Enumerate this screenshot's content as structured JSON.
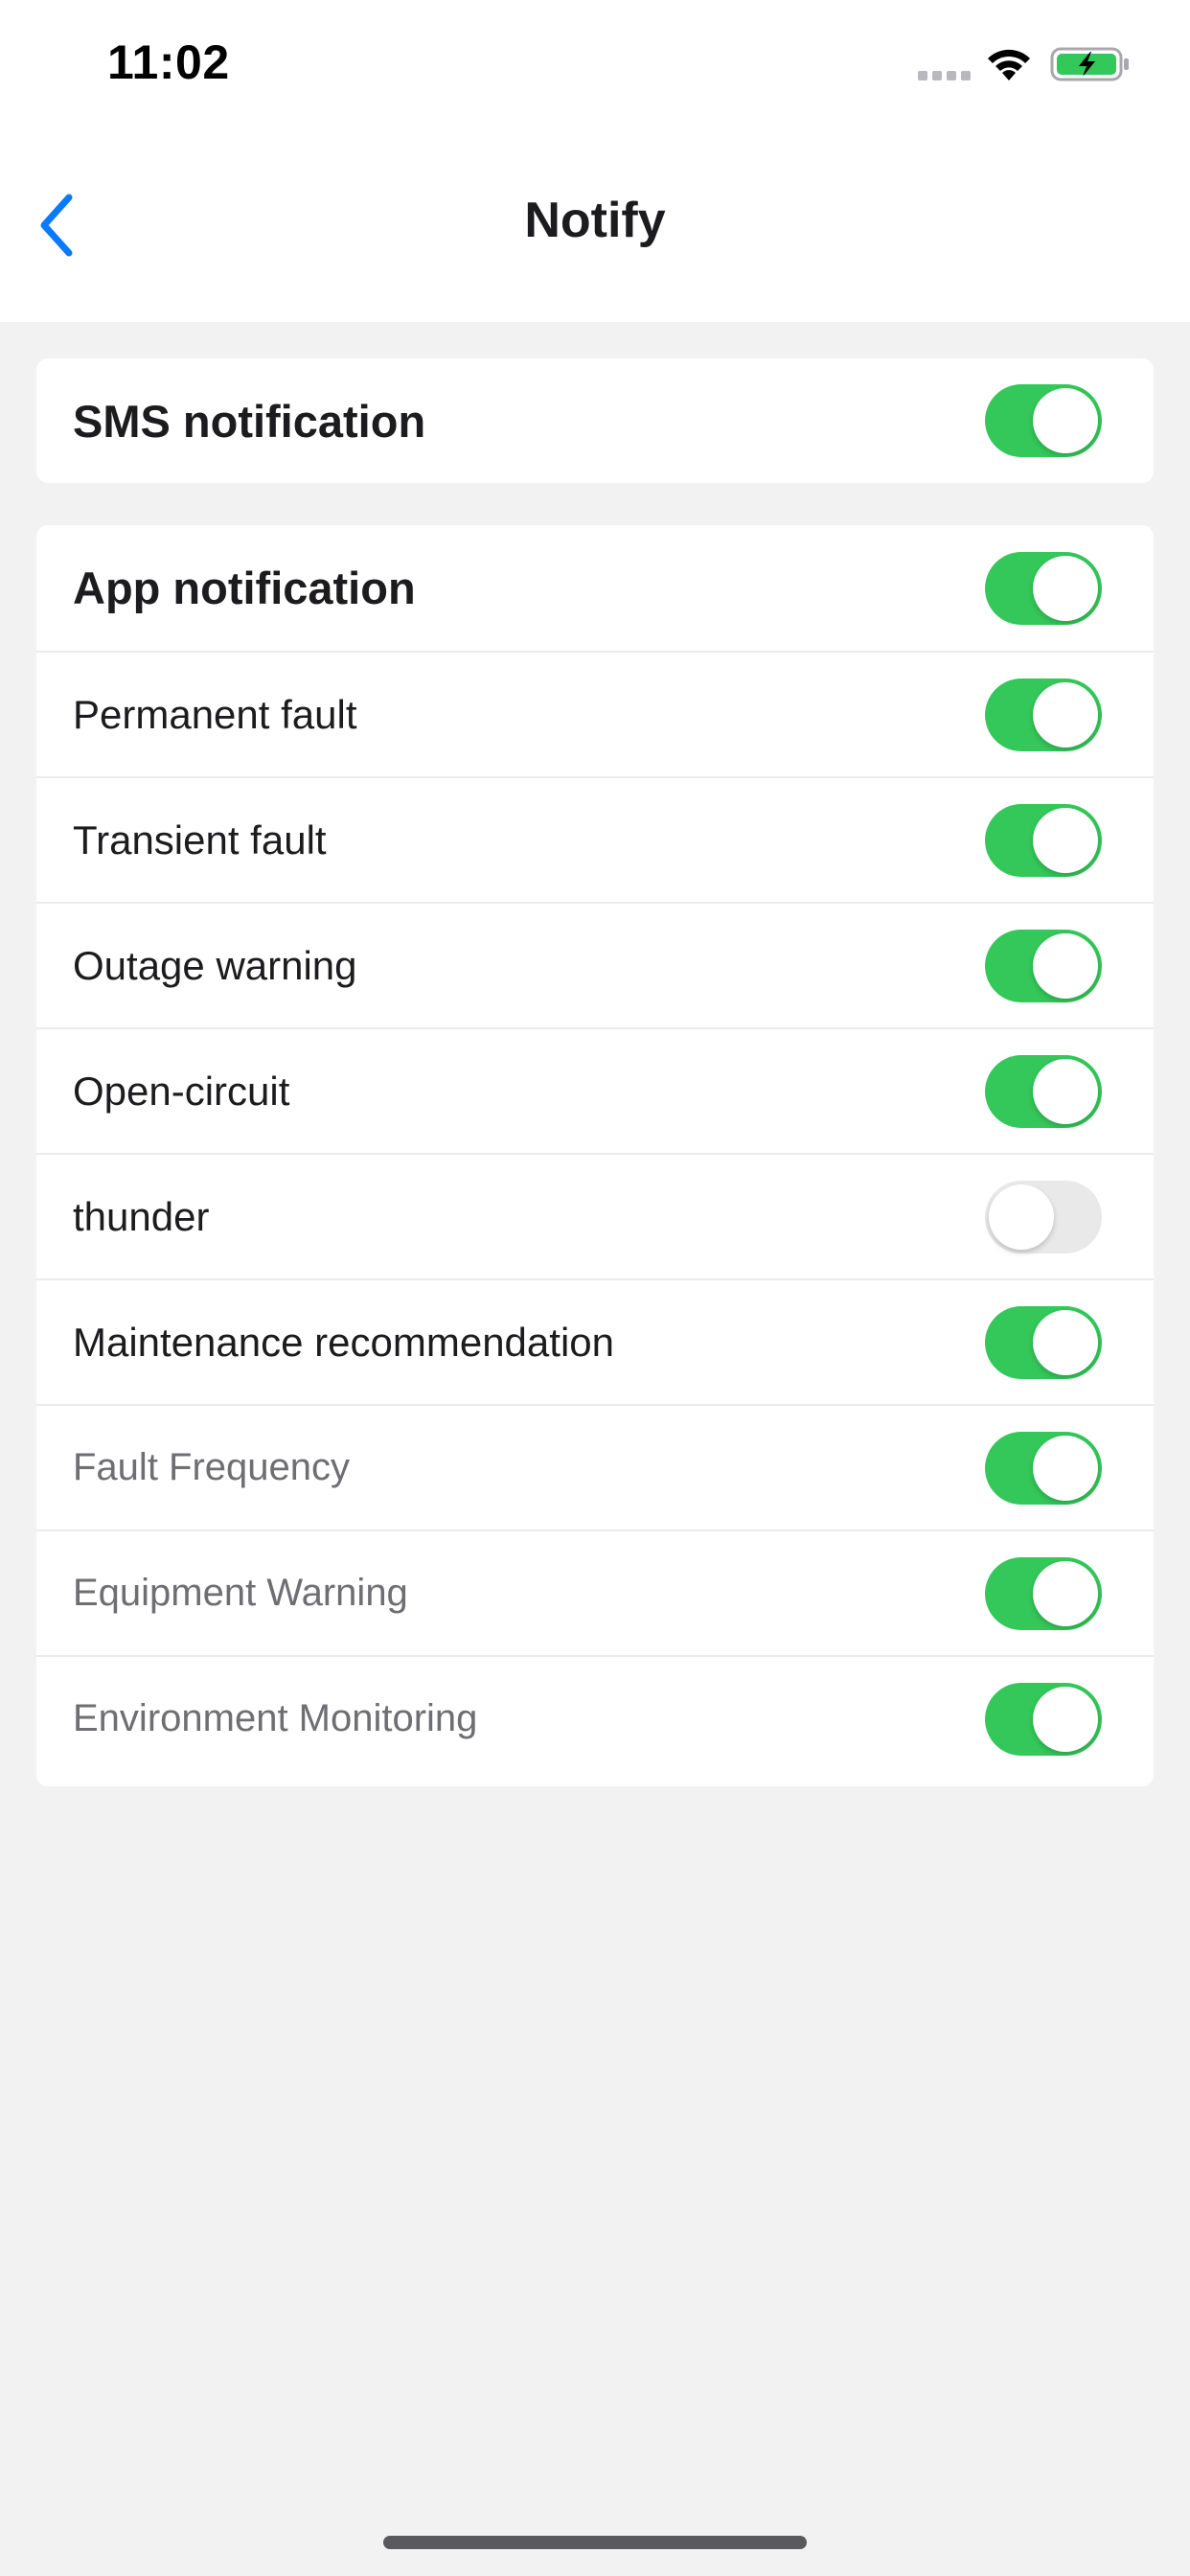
{
  "status_bar": {
    "time": "11:02",
    "signal_icon": "signal-dots-icon",
    "wifi_icon": "wifi-icon",
    "battery_icon": "battery-charging-icon"
  },
  "nav": {
    "title": "Notify",
    "back_icon": "chevron-left-icon"
  },
  "colors": {
    "accent_blue": "#0a7aff",
    "toggle_on": "#34c759",
    "toggle_off": "#e9e9ea",
    "background": "#f2f2f2"
  },
  "sms_card": {
    "label": "SMS notification",
    "enabled": true
  },
  "app_card": {
    "header": {
      "label": "App notification",
      "enabled": true
    },
    "items": [
      {
        "label": "Permanent fault",
        "enabled": true
      },
      {
        "label": "Transient fault",
        "enabled": true
      },
      {
        "label": "Outage warning",
        "enabled": true
      },
      {
        "label": "Open-circuit",
        "enabled": true
      },
      {
        "label": "thunder",
        "enabled": false
      },
      {
        "label": "Maintenance recommendation",
        "enabled": true
      },
      {
        "label": "Fault Frequency",
        "enabled": true
      },
      {
        "label": "Equipment Warning",
        "enabled": true
      },
      {
        "label": "Environment Monitoring",
        "enabled": true
      }
    ]
  }
}
